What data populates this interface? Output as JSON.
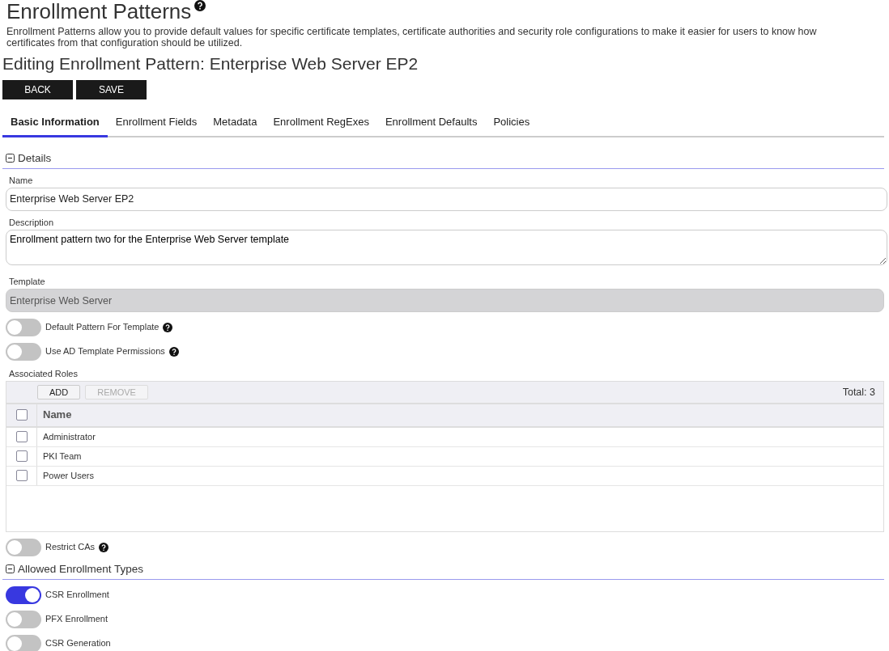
{
  "page": {
    "title": "Enrollment Patterns",
    "help": true,
    "description": "Enrollment Patterns allow you to provide default values for specific certificate templates, certificate authorities and security role configurations to make it easier for users to know how certificates from that configuration should be utilized.",
    "subtitle": "Editing Enrollment Pattern: Enterprise Web Server EP2"
  },
  "buttons": [
    {
      "label": "BACK"
    },
    {
      "label": "SAVE"
    }
  ],
  "tabs": [
    {
      "label": "Basic Information",
      "selected": true
    },
    {
      "label": "Enrollment Fields",
      "selected": false
    },
    {
      "label": "Metadata",
      "selected": false
    },
    {
      "label": "Enrollment RegExes",
      "selected": false
    },
    {
      "label": "Enrollment Defaults",
      "selected": false
    },
    {
      "label": "Policies",
      "selected": false
    }
  ],
  "sections": [
    {
      "title": "Details",
      "expanded": true,
      "items": [
        {
          "kind": "text",
          "label": "Name",
          "value": "Enterprise Web Server EP2"
        },
        {
          "kind": "textarea",
          "label": "Description",
          "value": "Enrollment pattern two for the Enterprise Web Server template"
        },
        {
          "kind": "readonly",
          "label": "Template",
          "value": "Enterprise Web Server"
        },
        {
          "kind": "toggle",
          "label": "Default Pattern For Template",
          "on": false,
          "help": true
        },
        {
          "kind": "toggle",
          "label": "Use AD Template Permissions",
          "on": false,
          "help": true
        },
        {
          "kind": "grid",
          "label": "Associated Roles",
          "toolbar": [
            {
              "label": "ADD",
              "disabled": false
            },
            {
              "label": "REMOVE",
              "disabled": true
            }
          ],
          "total": "Total: 3",
          "column": "Name",
          "all_checked": false,
          "rows": [
            {
              "name": "Administrator",
              "checked": false
            },
            {
              "name": "PKI Team",
              "checked": false
            },
            {
              "name": "Power Users",
              "checked": false
            }
          ]
        },
        {
          "kind": "toggle",
          "label": "Restrict CAs",
          "on": false,
          "help": true
        }
      ]
    },
    {
      "title": "Allowed Enrollment Types",
      "expanded": true,
      "items": [
        {
          "kind": "toggle",
          "label": "CSR Enrollment",
          "on": true,
          "help": false
        },
        {
          "kind": "toggle",
          "label": "PFX Enrollment",
          "on": false,
          "help": false
        },
        {
          "kind": "toggle",
          "label": "CSR Generation",
          "on": false,
          "help": false
        }
      ]
    }
  ]
}
